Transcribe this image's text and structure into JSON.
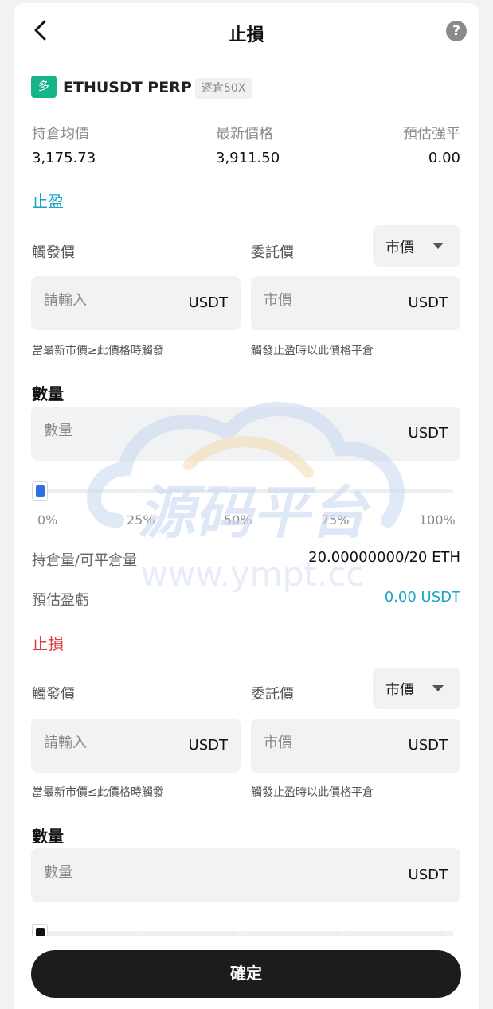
{
  "header": {
    "title": "止損"
  },
  "position": {
    "side": "多",
    "symbol": "ETHUSDT PERP",
    "margin_tag": "逐倉50X"
  },
  "stats": {
    "avg_price_label": "持倉均價",
    "avg_price": "3,175.73",
    "last_price_label": "最新價格",
    "last_price": "3,911.50",
    "liq_label": "預估強平",
    "liq_price": "0.00"
  },
  "take_profit": {
    "title": "止盈",
    "trigger_label": "觸發價",
    "order_label": "委託價",
    "order_type": "市價",
    "trigger_placeholder": "請輸入",
    "trigger_unit": "USDT",
    "order_placeholder": "市價",
    "order_unit": "USDT",
    "trigger_hint": "當最新市價≥此價格時觸發",
    "order_hint": "觸發止盈時以此價格平倉",
    "qty_title": "數量",
    "qty_placeholder": "數量",
    "qty_unit": "USDT",
    "slider_value": 0,
    "slider_marks": [
      "0%",
      "25%",
      "50%",
      "75%",
      "100%"
    ],
    "position_label": "持倉量/可平倉量",
    "position_value": "20.00000000/20 ETH",
    "pnl_label": "預估盈虧",
    "pnl_value": "0.00 USDT"
  },
  "stop_loss": {
    "title": "止損",
    "trigger_label": "觸發價",
    "order_label": "委託價",
    "order_type": "市價",
    "trigger_placeholder": "請輸入",
    "trigger_unit": "USDT",
    "order_placeholder": "市價",
    "order_unit": "USDT",
    "trigger_hint": "當最新市價≤此價格時觸發",
    "order_hint": "觸發止盈時以此價格平倉",
    "qty_title": "數量",
    "qty_placeholder": "數量",
    "qty_unit": "USDT",
    "slider_value": 0
  },
  "watermark": {
    "text": "源码平台",
    "url": "www.ympt.cc"
  },
  "footer": {
    "confirm_label": "確定"
  },
  "colors": {
    "long": "#16b48a",
    "take_profit": "#1aa3c4",
    "stop_loss": "#e03a3a",
    "slider_handle": "#2f6fe6"
  }
}
